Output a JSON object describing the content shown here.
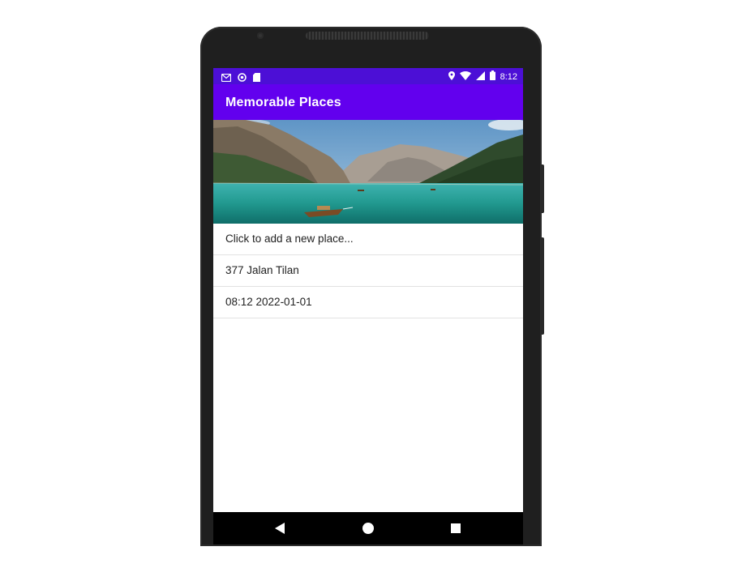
{
  "status_bar": {
    "left_icons": [
      "gmail-icon",
      "sync-icon",
      "sd-card-icon"
    ],
    "right_icons": [
      "location-icon",
      "wifi-icon",
      "signal-icon",
      "battery-icon"
    ],
    "time": "8:12"
  },
  "app_bar": {
    "title": "Memorable Places"
  },
  "hero_image": {
    "subject": "mountain-lake-with-boat"
  },
  "places": [
    {
      "label": "Click to add a new place..."
    },
    {
      "label": "377 Jalan Tilan"
    },
    {
      "label": "08:12 2022-01-01"
    }
  ],
  "nav_bar": {
    "buttons": [
      "back-icon",
      "home-icon",
      "recents-icon"
    ]
  },
  "colors": {
    "app_bar": "#6200ee",
    "status_bar": "#4c0fd6",
    "nav_bar": "#000000",
    "phone_body": "#1f1f1f"
  }
}
